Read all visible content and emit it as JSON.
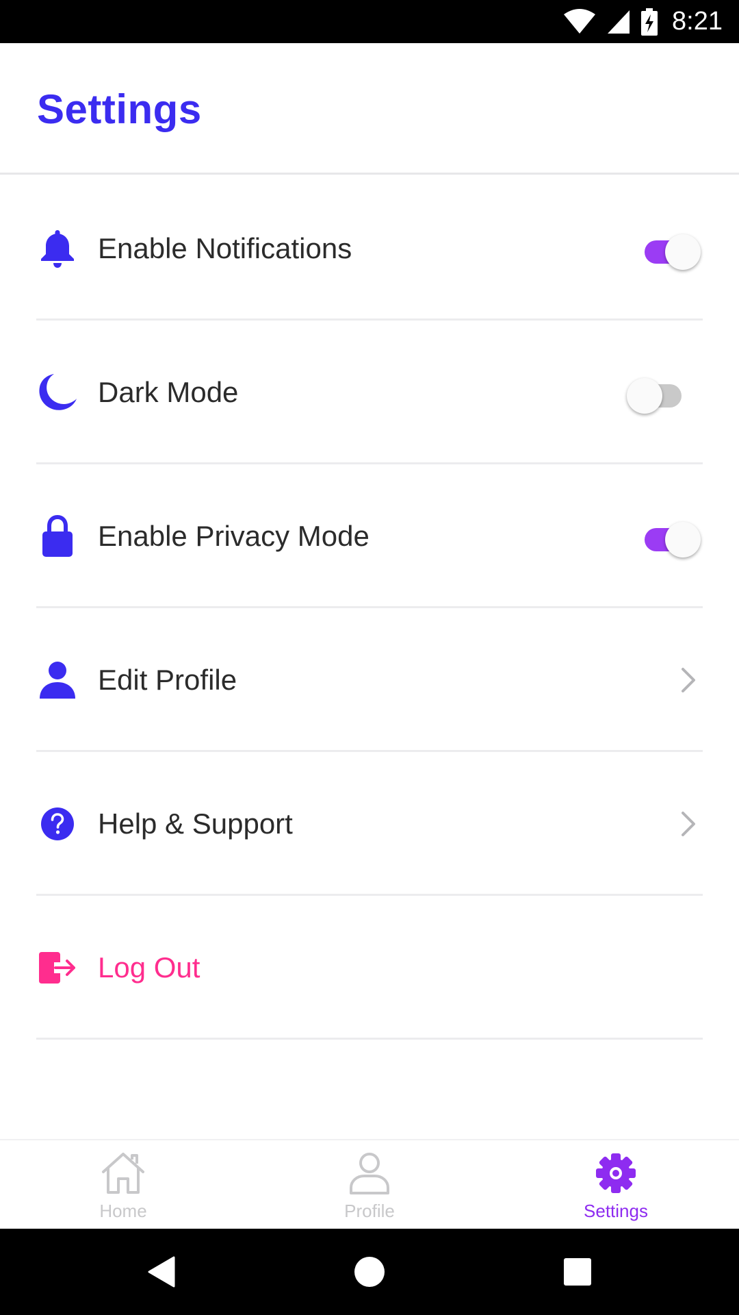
{
  "status_bar": {
    "time": "8:21",
    "icons": [
      "wifi-icon",
      "cell-signal-icon",
      "battery-charging-icon"
    ]
  },
  "header": {
    "title": "Settings"
  },
  "settings": {
    "items": [
      {
        "label": "Enable Notifications",
        "icon": "bell-icon",
        "control": "toggle",
        "on": true
      },
      {
        "label": "Dark Mode",
        "icon": "moon-icon",
        "control": "toggle",
        "on": false
      },
      {
        "label": "Enable Privacy Mode",
        "icon": "lock-icon",
        "control": "toggle",
        "on": true
      },
      {
        "label": "Edit Profile",
        "icon": "person-icon",
        "control": "chevron"
      },
      {
        "label": "Help & Support",
        "icon": "question-circle-icon",
        "control": "chevron"
      },
      {
        "label": "Log Out",
        "icon": "logout-icon",
        "control": "none"
      }
    ]
  },
  "bottom_nav": {
    "items": [
      {
        "label": "Home",
        "icon": "home-icon",
        "active": false
      },
      {
        "label": "Profile",
        "icon": "profile-icon",
        "active": false
      },
      {
        "label": "Settings",
        "icon": "gear-icon",
        "active": true
      }
    ]
  },
  "system_nav": {
    "buttons": [
      "back-icon",
      "home-circle-icon",
      "recents-icon"
    ]
  },
  "colors": {
    "primary": "#3b2cf0",
    "toggle_on": "#9b3cf4",
    "toggle_off": "#c9c9c9",
    "logout": "#ff2d8e",
    "nav_active": "#8e2cf0",
    "nav_inactive": "#c8c8ca"
  }
}
